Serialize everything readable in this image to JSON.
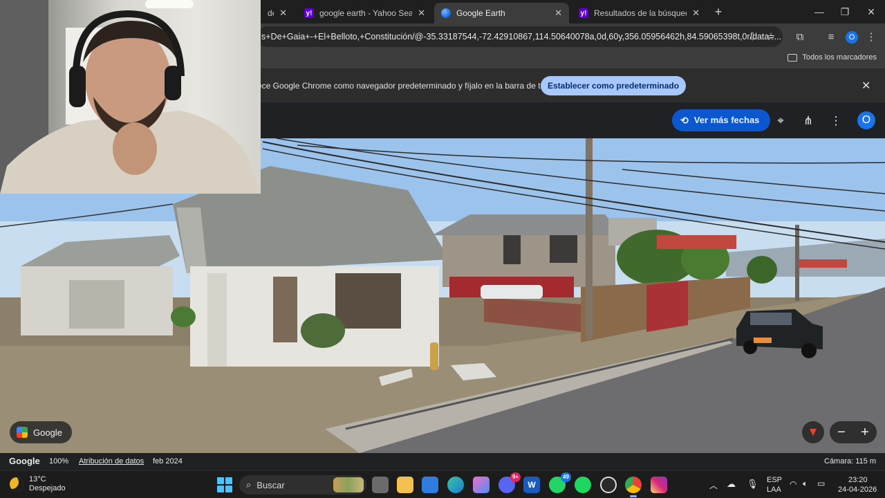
{
  "browser": {
    "tabs": [
      {
        "title": "de",
        "favicon": "globe-icon",
        "active": false
      },
      {
        "title": "google earth - Yahoo Search Tu",
        "favicon": "yahoo-icon",
        "active": false
      },
      {
        "title": "Google Earth",
        "favicon": "google-earth-icon",
        "active": true
      },
      {
        "title": "Resultados de la búsqueda de",
        "favicon": "yahoo-icon",
        "active": false
      }
    ],
    "new_tab_label": "+",
    "address": "s+De+Gaia+-+El+Belloto,+Constitución/@-35.33187544,-72.42910867,114.50640078a,0d,60y,356.05956462h,84.59065398t,0r/data=...",
    "profile_initial": "O",
    "bookmarks_label": "Todos los marcadores",
    "infobar_message": "ece Google Chrome como navegador predeterminado y fíjalo en la barra de tareas",
    "infobar_button": "Establecer como predeterminado",
    "colors": {
      "accent": "#a8c7fa",
      "tab_active": "#3c3c3c",
      "frame": "#1f1f1f"
    }
  },
  "earth": {
    "more_dates_label": "Ver más fechas",
    "profile_initial": "O",
    "street_view_badge": "Google",
    "status": {
      "logo": "Google",
      "zoom": "100%",
      "attribution": "Atribución de datos",
      "date": "feb 2024",
      "camera": "Cámara: 115 m"
    },
    "colors": {
      "button": "#0b57d0",
      "compass": "#ea4335"
    }
  },
  "taskbar": {
    "weather_temp": "13°C",
    "weather_desc": "Despejado",
    "search_placeholder": "Buscar",
    "apps": [
      {
        "name": "task-view-icon",
        "badge": ""
      },
      {
        "name": "file-explorer-icon",
        "badge": ""
      },
      {
        "name": "store-icon",
        "badge": ""
      },
      {
        "name": "edge-icon",
        "badge": ""
      },
      {
        "name": "copilot-icon",
        "badge": ""
      },
      {
        "name": "discord-icon",
        "badge": "9+"
      },
      {
        "name": "word-icon",
        "badge": ""
      },
      {
        "name": "whatsapp-icon",
        "badge": "49"
      },
      {
        "name": "spotify-icon",
        "badge": ""
      },
      {
        "name": "steelseries-icon",
        "badge": ""
      },
      {
        "name": "chrome-icon",
        "badge": ""
      },
      {
        "name": "instagram-icon",
        "badge": ""
      }
    ],
    "language": "ESP",
    "layout": "LAA",
    "time": "23:20",
    "date": "24-04-2026"
  }
}
